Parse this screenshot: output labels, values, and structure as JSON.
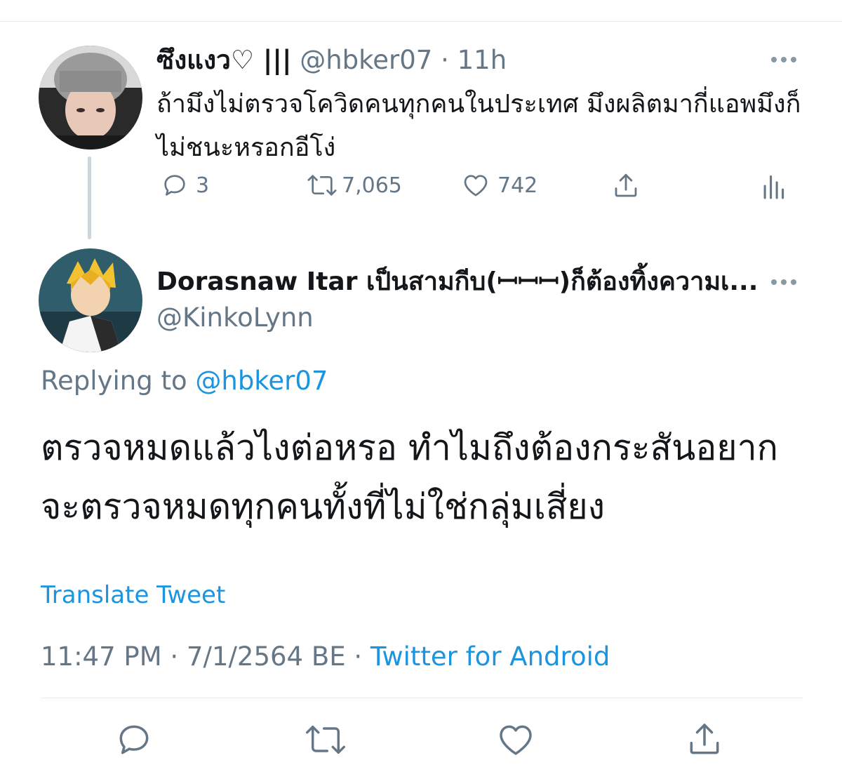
{
  "parent_tweet": {
    "display_name": "ซึงแงว♡ |||",
    "handle": "@hbker07",
    "time": "11h",
    "text": "ถ้ามึงไม่ตรวจโควิดคนทุกคนในประเทศ มึงผลิตมากี่แอพมึงก็ไม่ชนะหรอกอีโง่",
    "counts": {
      "replies": "3",
      "retweets": "7,065",
      "likes": "742"
    },
    "icons": [
      "reply-icon",
      "retweet-icon",
      "like-icon",
      "share-icon",
      "analytics-icon",
      "more-icon"
    ]
  },
  "main_tweet": {
    "display_name": "Dorasnaw Itar เป็นสามกีบ(ꟷꟷꟷ)ก็ต้องทิ้งความเ...",
    "handle": "@KinkoLynn",
    "replying_prefix": "Replying to",
    "replying_to": "@hbker07",
    "text": "ตรวจหมดแล้วไงต่อหรอ ทำไมถึงต้องกระสันอยากจะตรวจหมดทุกคนทั้งที่ไม่ใช่กลุ่มเสี่ยง",
    "translate_label": "Translate Tweet",
    "timestamp": "11:47 PM · 7/1/2564 BE · ",
    "source": "Twitter for Android",
    "icons": [
      "reply-icon",
      "retweet-icon",
      "like-icon",
      "share-icon",
      "more-icon"
    ]
  },
  "colors": {
    "text_primary": "#14171a",
    "text_secondary": "#657786",
    "link": "#1b95e0",
    "divider": "#e6ecf0",
    "thread_line": "#ccd6dd"
  }
}
